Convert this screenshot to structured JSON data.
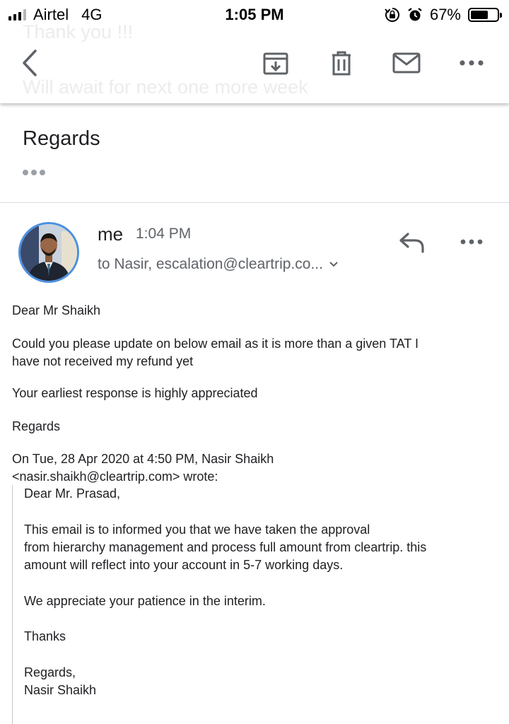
{
  "status_bar": {
    "carrier": "Airtel",
    "network": "4G",
    "time": "1:05 PM",
    "battery": "67%",
    "battery_level": 0.67,
    "icons": [
      "signal-icon",
      "orientation-lock-icon",
      "alarm-icon",
      "battery-icon"
    ]
  },
  "background_preview": {
    "line1": "Thank you !!!",
    "line2": "Will await for next one more week"
  },
  "toolbar": {
    "icons": [
      "back-icon",
      "archive-icon",
      "trash-icon",
      "mail-icon",
      "more-icon"
    ]
  },
  "previous_message": {
    "closing": "Regards"
  },
  "message": {
    "sender": "me",
    "time": "1:04 PM",
    "recipients": "to Nasir, escalation@cleartrip.co...",
    "body": {
      "greeting": "Dear Mr Shaikh",
      "para1_line1": "Could you please update on below email as it is  more than a given TAT I",
      "para1_line2": "have not received my refund yet",
      "para2": "Your earliest response is highly appreciated",
      "closing": "Regards",
      "quote_header_line1": "On Tue, 28 Apr 2020 at 4:50 PM, Nasir Shaikh",
      "quote_header_line2": "<nasir.shaikh@cleartrip.com> wrote:"
    },
    "quoted": {
      "greeting": "Dear Mr. Prasad,",
      "line1": "This email is to informed you that we have taken the approval",
      "line2": "from hierarchy management and process full amount from cleartrip. this",
      "line3": "amount will reflect into your account in 5-7 working days.",
      "appreciation": "We appreciate your patience in the interim.",
      "thanks": "Thanks",
      "regards": "Regards,",
      "signature": "Nasir Shaikh"
    }
  },
  "colors": {
    "accent_blue": "#4a90e2",
    "icon_gray": "#5f6368",
    "text": "#202124"
  }
}
